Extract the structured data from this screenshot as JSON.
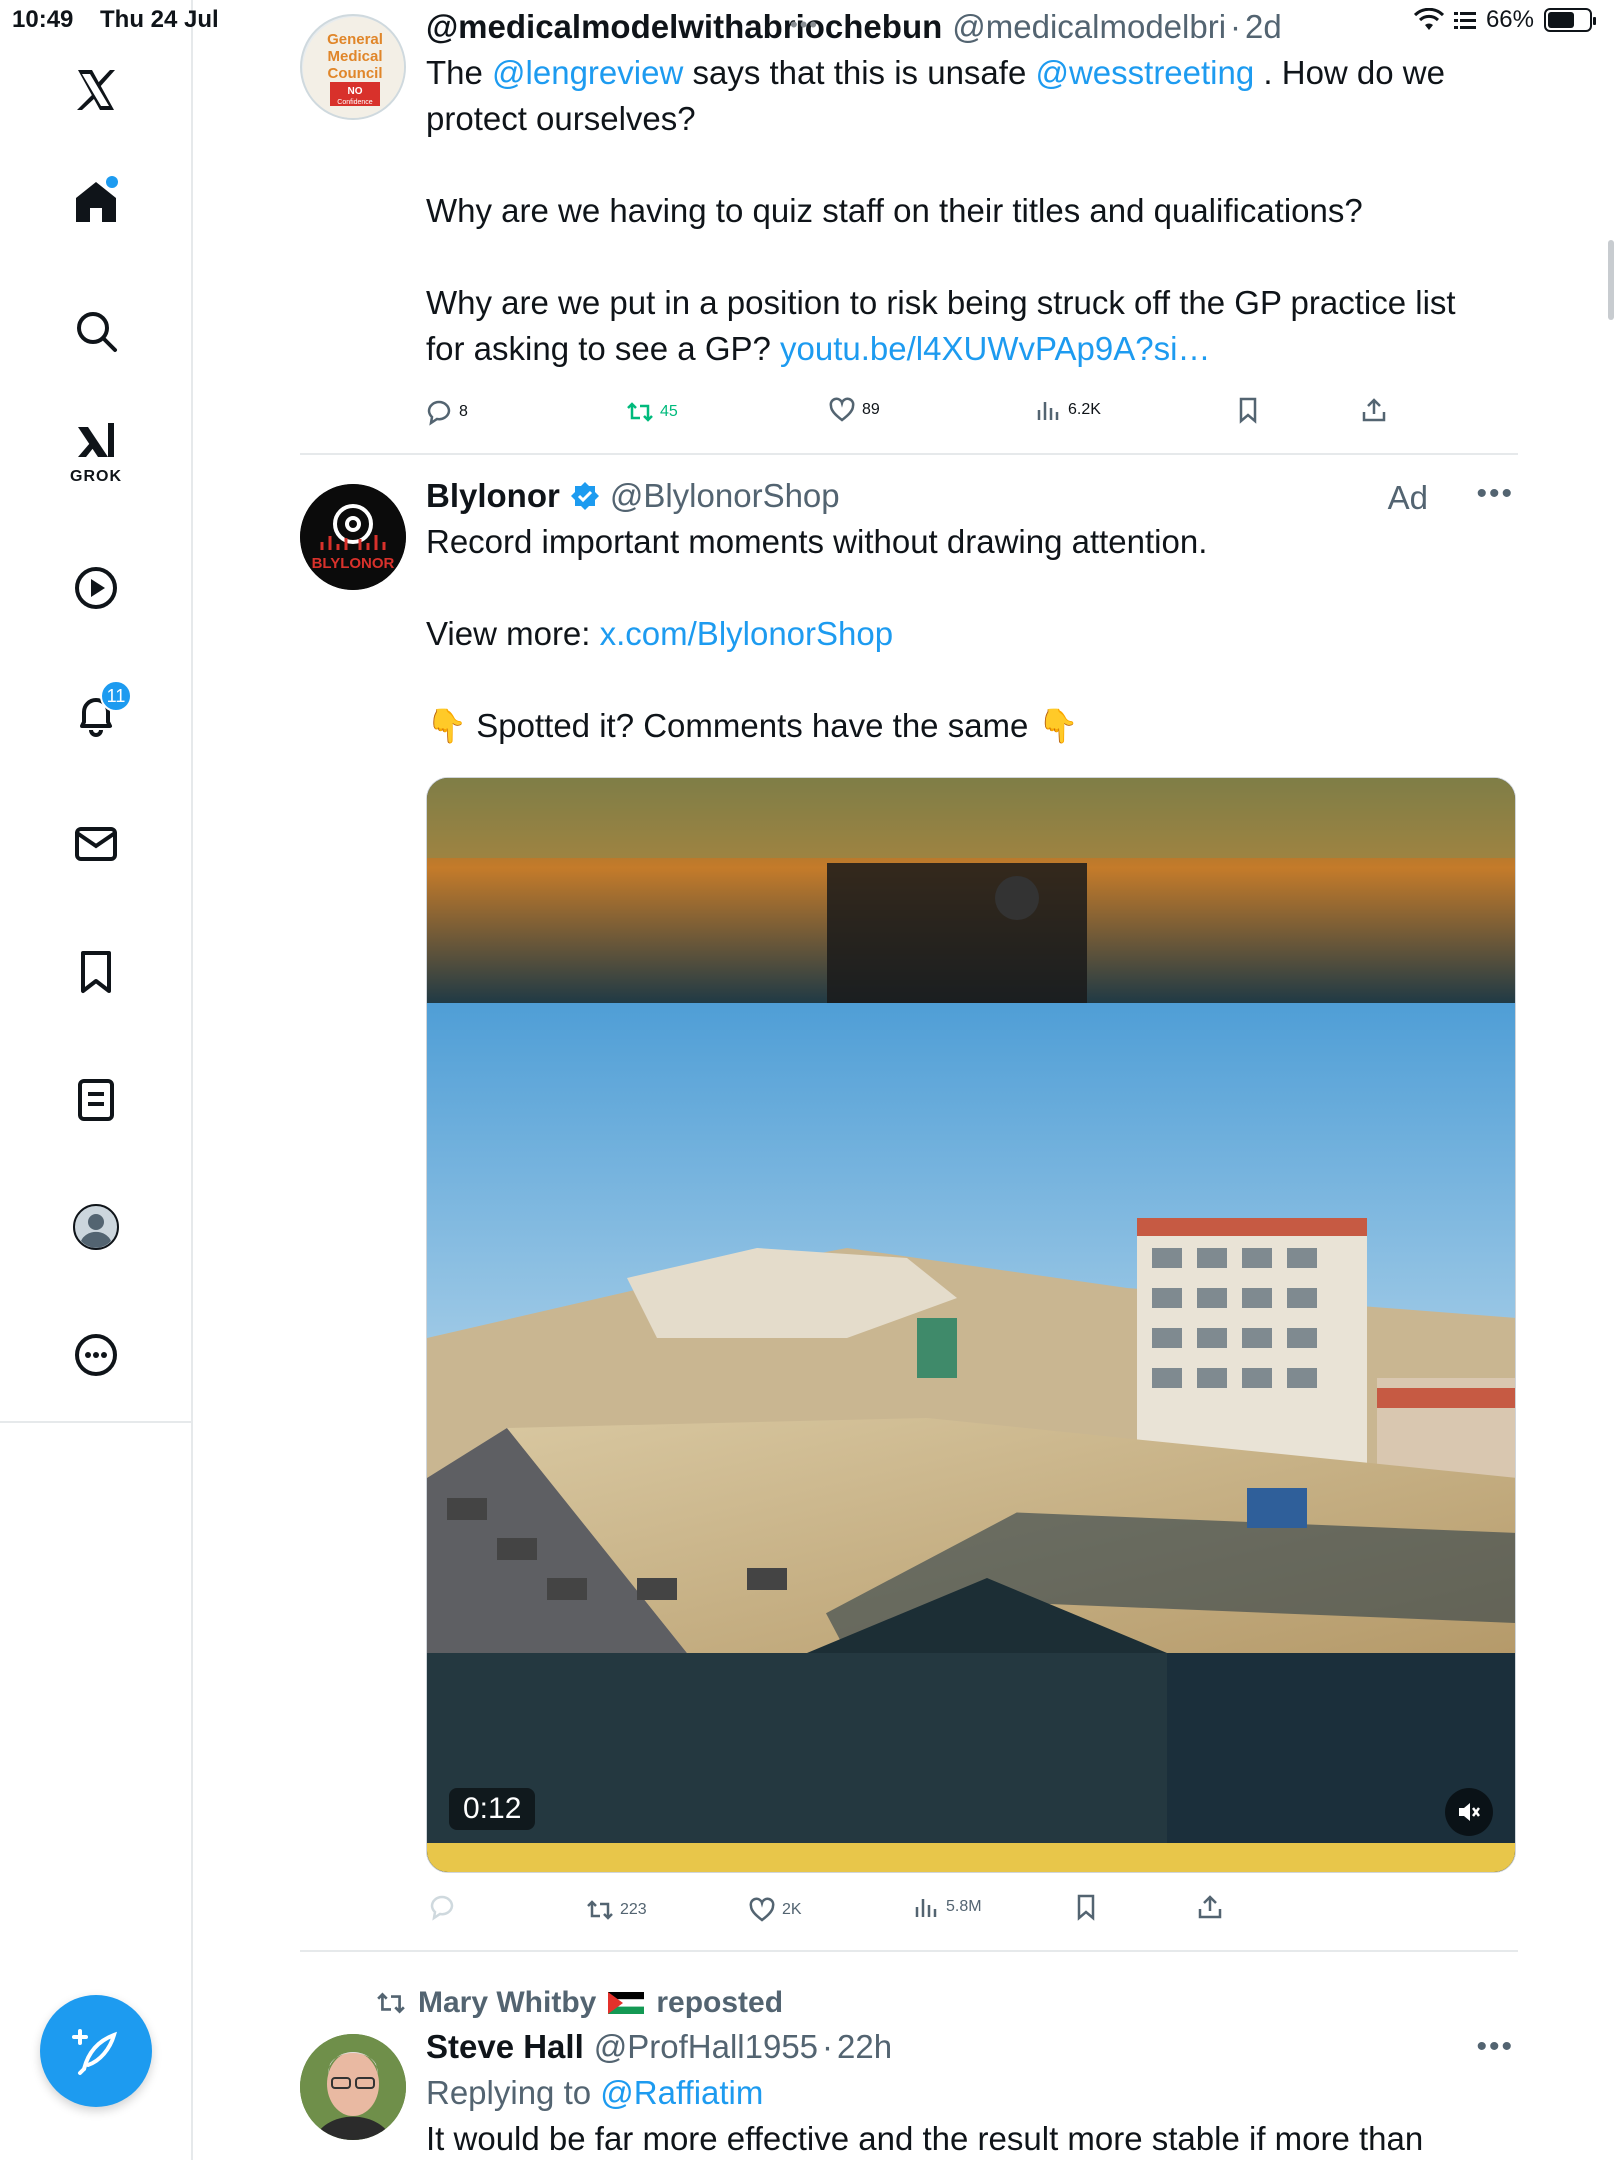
{
  "status_bar": {
    "time": "10:49",
    "date": "Thu 24 Jul",
    "battery_percent": "66%",
    "battery_level": 0.66
  },
  "sidebar": {
    "grok_label": "GROK",
    "notifications_count": "11"
  },
  "tweet1": {
    "display_name": "@medicalmodelwithabriochebun",
    "handle": "@medicalmodelbri",
    "separator": "·",
    "time": "2d",
    "avatar_text": [
      "General",
      "Medical",
      "Council",
      "NO",
      "Confidence"
    ],
    "text": {
      "l1_a": "The ",
      "l1_link1": "@lengreview",
      "l1_b": " says that this is unsafe ",
      "l1_link2": "@wesstreeting",
      "l1_c": " . How do we",
      "l2": "protect ourselves?",
      "p2": "Why are we having to quiz staff on their titles and qualifications?",
      "p3_l1": "Why are we put in a position to risk being struck off the GP practice list",
      "p3_l2a": "for asking to see a GP?  ",
      "p3_link": "youtu.be/l4XUWvPAp9A?si…"
    },
    "replies": "8",
    "reposts": "45",
    "likes": "89",
    "views": "6.2K"
  },
  "tweet2": {
    "display_name": "Blylonor",
    "handle": "@BlylonorShop",
    "ad_label": "Ad",
    "avatar_text": "BLYLONOR",
    "text": {
      "p1": "Record important moments without drawing attention.",
      "p2_a": "View more: ",
      "p2_link": "x.com/BlylonorShop",
      "p3_emoji_left": "👇",
      "p3": " Spotted it? Comments have the same ",
      "p3_emoji_right": "👇"
    },
    "video_time": "0:12",
    "replies": "",
    "reposts": "223",
    "likes": "2K",
    "views": "5.8M"
  },
  "tweet3": {
    "reposted_by": "Mary Whitby",
    "reposted_label": "reposted",
    "display_name": "Steve Hall",
    "handle": "@ProfHall1955",
    "separator": "·",
    "time": "22h",
    "replying_label": "Replying to ",
    "replying_link": "@Raffiatim",
    "text_partial": "It would be far more effective and the result more stable if more than"
  },
  "colors": {
    "accent": "#1d9bf0",
    "repost_green": "#00ba7c",
    "muted": "#536471"
  }
}
